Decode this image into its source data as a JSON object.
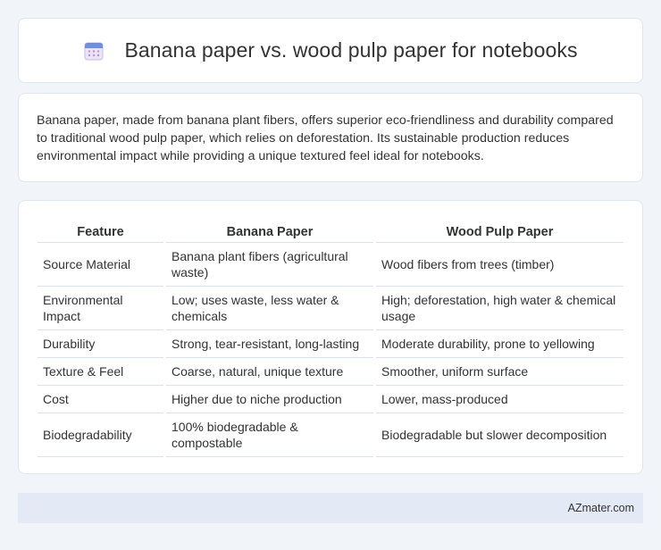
{
  "header": {
    "title": "Banana paper vs. wood pulp paper for notebooks",
    "icon": "calendar-icon"
  },
  "summary": {
    "text": "Banana paper, made from banana plant fibers, offers superior eco-friendliness and durability compared to traditional wood pulp paper, which relies on deforestation. Its sustainable production reduces environmental impact while providing a unique textured feel ideal for notebooks."
  },
  "table": {
    "headers": [
      "Feature",
      "Banana Paper",
      "Wood Pulp Paper"
    ],
    "rows": [
      [
        "Source Material",
        "Banana plant fibers (agricultural waste)",
        "Wood fibers from trees (timber)"
      ],
      [
        "Environmental Impact",
        "Low; uses waste, less water & chemicals",
        "High; deforestation, high water & chemical usage"
      ],
      [
        "Durability",
        "Strong, tear-resistant, long-lasting",
        "Moderate durability, prone to yellowing"
      ],
      [
        "Texture & Feel",
        "Coarse, natural, unique texture",
        "Smoother, uniform surface"
      ],
      [
        "Cost",
        "Higher due to niche production",
        "Lower, mass-produced"
      ],
      [
        "Biodegradability",
        "100% biodegradable & compostable",
        "Biodegradable but slower decomposition"
      ]
    ]
  },
  "footer": {
    "text": "AZmater.com"
  }
}
